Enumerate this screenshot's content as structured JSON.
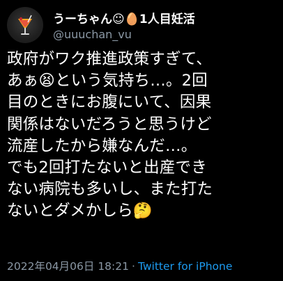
{
  "author": {
    "display_name": "うーちゃん☺🥚1人目妊活",
    "handle": "@uuuchan_vu",
    "avatar_icon": "cocktail-glass-icon"
  },
  "tweet": {
    "text": "政府がワク推進政策すぎて、\nあぁ😫という気持ち…。2回\n目のときにお腹にいて、因果\n関係はないだろうと思うけど\n流産したから嫌なんだ…。\nでも2回打たないと出産でき\nない病院も多いし、また打た\nないとダメかしら🤔"
  },
  "meta": {
    "timestamp": "2022年04月06日 18:21",
    "separator": "·",
    "source": "Twitter for iPhone"
  },
  "colors": {
    "background": "#000000",
    "text": "#ffffff",
    "secondary": "#8b98a5",
    "link": "#1d9bf0"
  }
}
